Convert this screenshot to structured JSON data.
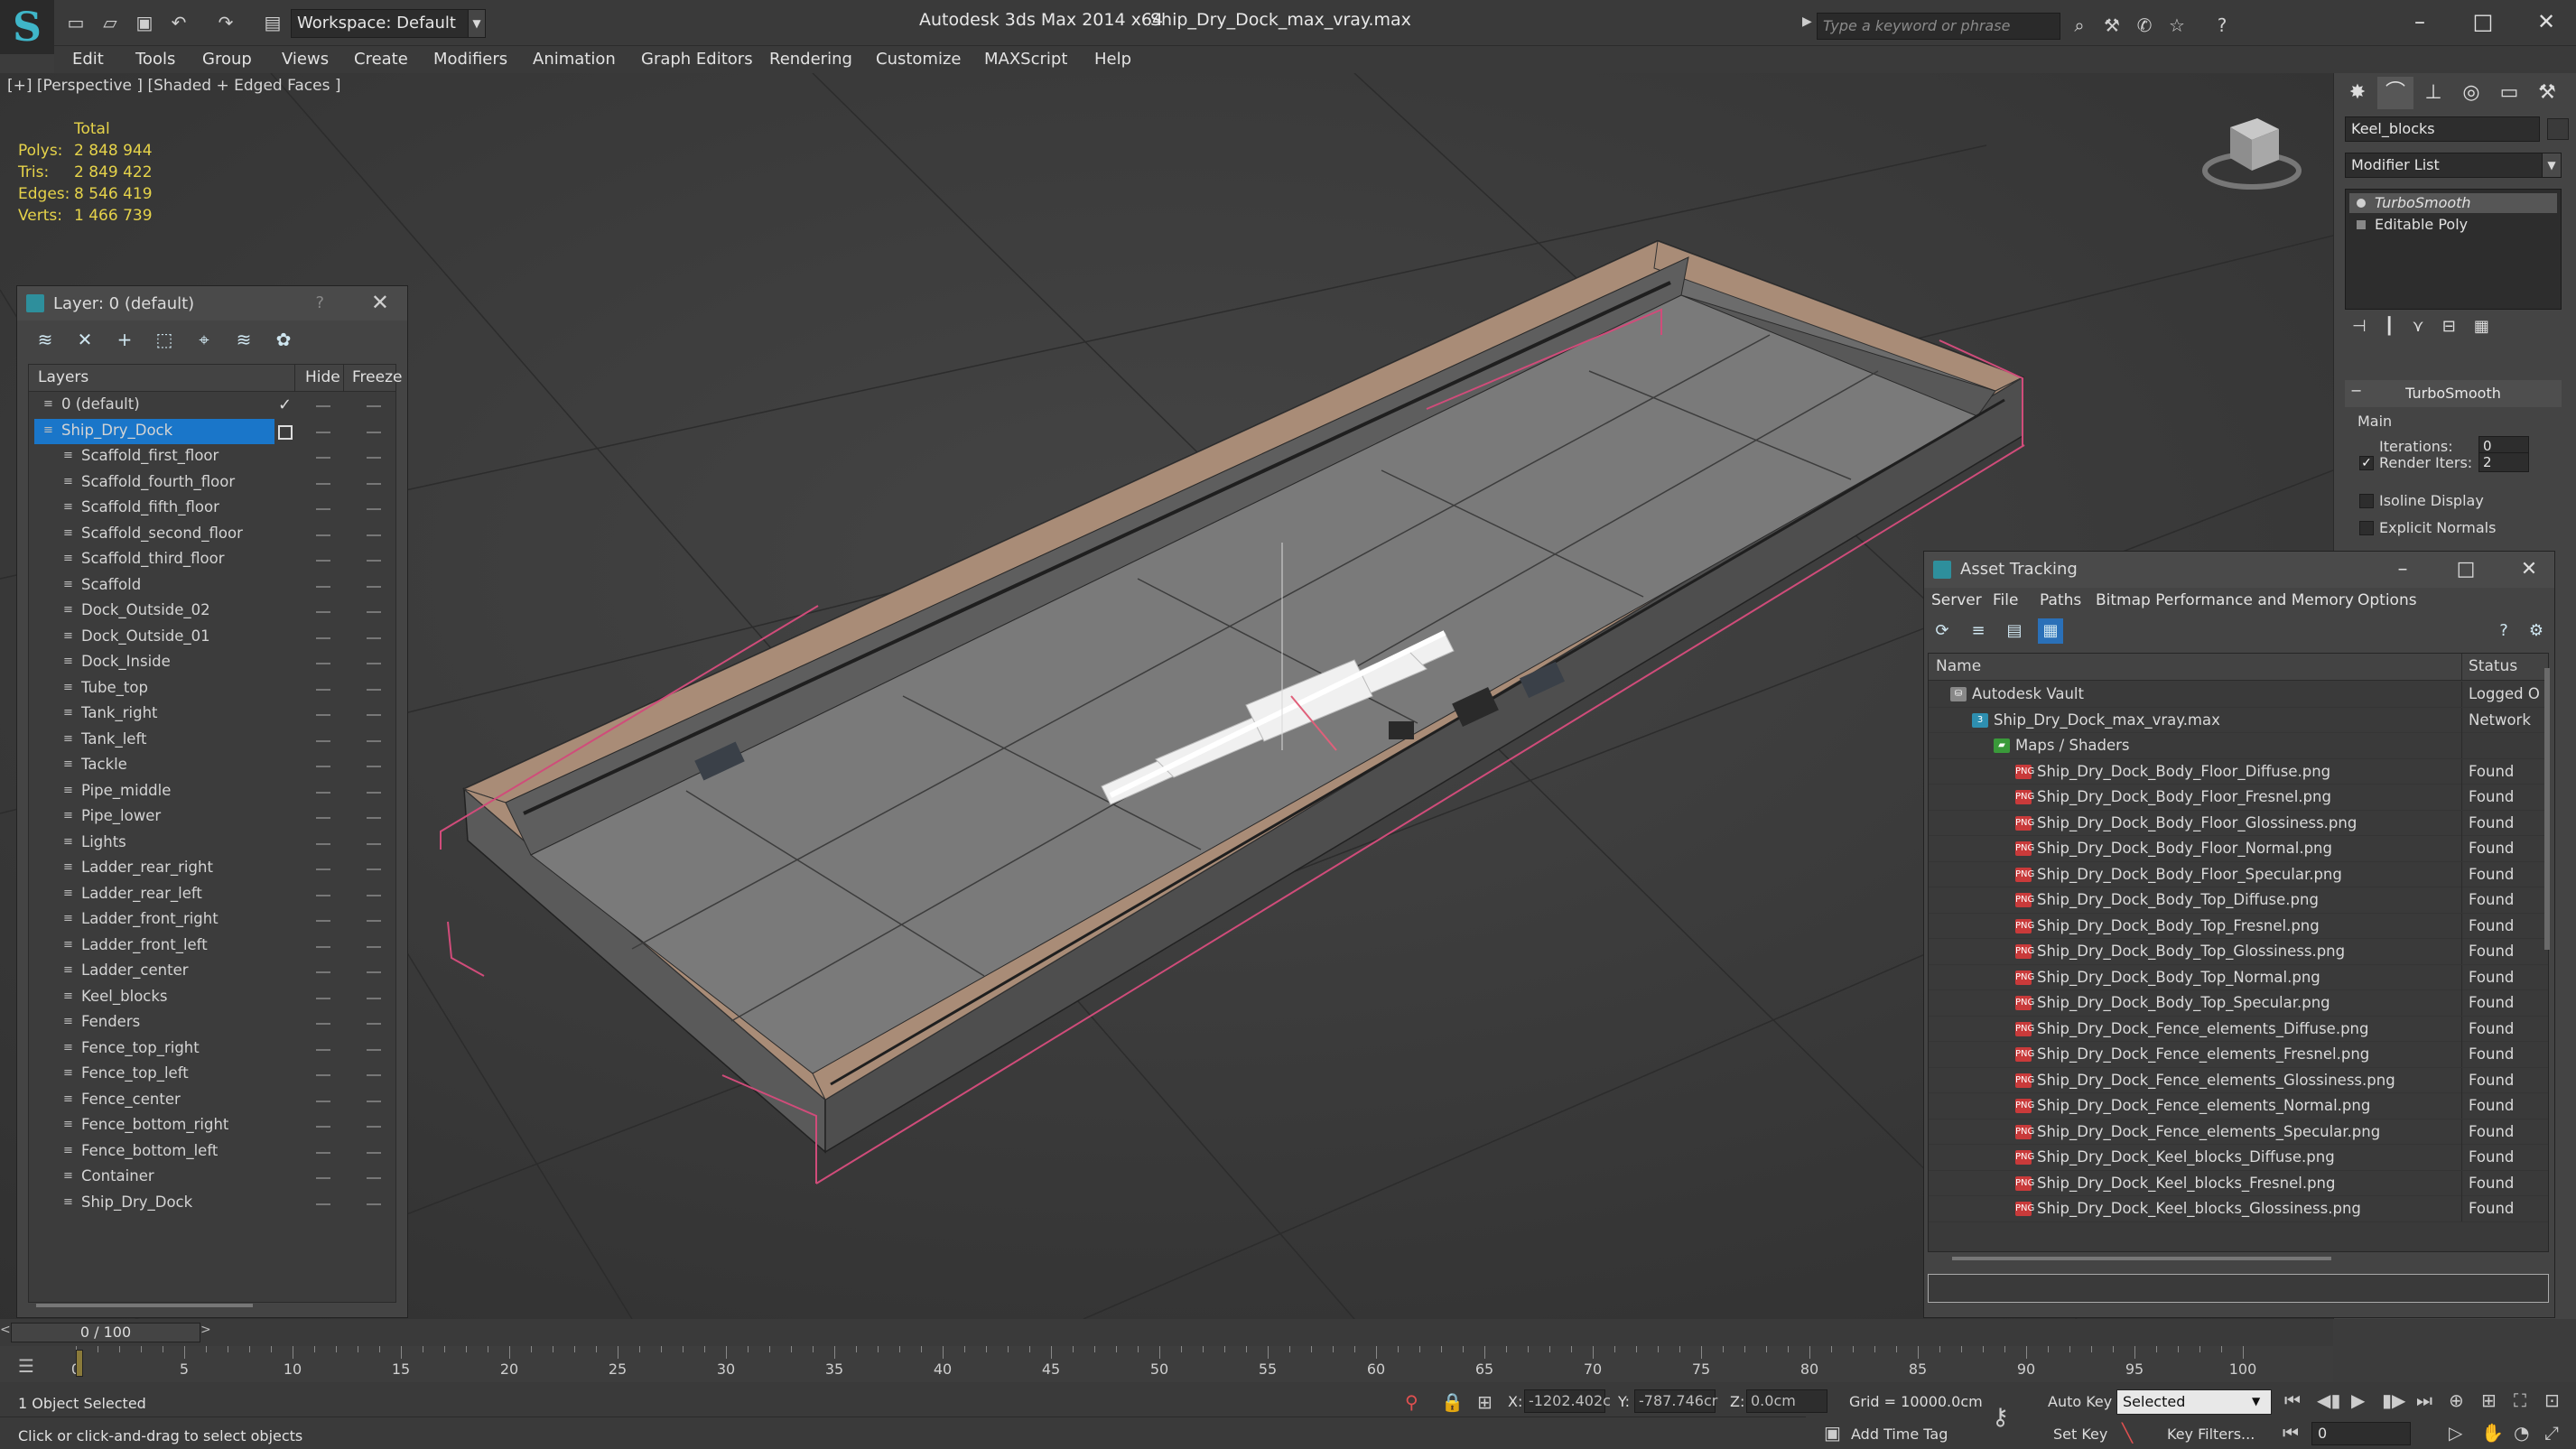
{
  "titlebar": {
    "workspace_label": "Workspace: Default",
    "app_title": "Autodesk 3ds Max  2014 x64",
    "file_title": "Ship_Dry_Dock_max_vray.max",
    "search_placeholder": "Type a keyword or phrase"
  },
  "menu": [
    "Edit",
    "Tools",
    "Group",
    "Views",
    "Create",
    "Modifiers",
    "Animation",
    "Graph Editors",
    "Rendering",
    "Customize",
    "MAXScript",
    "Help"
  ],
  "viewport": {
    "label": "[+] [Perspective ] [Shaded + Edged Faces ]",
    "stats": {
      "header": "Total",
      "rows": [
        {
          "k": "Polys:",
          "v": "2 848 944"
        },
        {
          "k": "Tris:",
          "v": "2 849 422"
        },
        {
          "k": "Edges:",
          "v": "8 546 419"
        },
        {
          "k": "Verts:",
          "v": "1 466 739"
        }
      ]
    }
  },
  "layer_panel": {
    "title": "Layer: 0 (default)",
    "help": "?",
    "col_layers": "Layers",
    "col_hide": "Hide",
    "col_freeze": "Freeze",
    "layers": [
      {
        "name": "0 (default)",
        "level": 0,
        "check": true
      },
      {
        "name": "Ship_Dry_Dock",
        "level": 0,
        "selected": true
      },
      {
        "name": "Scaffold_first_floor",
        "level": 1
      },
      {
        "name": "Scaffold_fourth_floor",
        "level": 1
      },
      {
        "name": "Scaffold_fifth_floor",
        "level": 1
      },
      {
        "name": "Scaffold_second_floor",
        "level": 1
      },
      {
        "name": "Scaffold_third_floor",
        "level": 1
      },
      {
        "name": "Scaffold",
        "level": 1
      },
      {
        "name": "Dock_Outside_02",
        "level": 1
      },
      {
        "name": "Dock_Outside_01",
        "level": 1
      },
      {
        "name": "Dock_Inside",
        "level": 1
      },
      {
        "name": "Tube_top",
        "level": 1
      },
      {
        "name": "Tank_right",
        "level": 1
      },
      {
        "name": "Tank_left",
        "level": 1
      },
      {
        "name": "Tackle",
        "level": 1
      },
      {
        "name": "Pipe_middle",
        "level": 1
      },
      {
        "name": "Pipe_lower",
        "level": 1
      },
      {
        "name": "Lights",
        "level": 1
      },
      {
        "name": "Ladder_rear_right",
        "level": 1
      },
      {
        "name": "Ladder_rear_left",
        "level": 1
      },
      {
        "name": "Ladder_front_right",
        "level": 1
      },
      {
        "name": "Ladder_front_left",
        "level": 1
      },
      {
        "name": "Ladder_center",
        "level": 1
      },
      {
        "name": "Keel_blocks",
        "level": 1
      },
      {
        "name": "Fenders",
        "level": 1
      },
      {
        "name": "Fence_top_right",
        "level": 1
      },
      {
        "name": "Fence_top_left",
        "level": 1
      },
      {
        "name": "Fence_center",
        "level": 1
      },
      {
        "name": "Fence_bottom_right",
        "level": 1
      },
      {
        "name": "Fence_bottom_left",
        "level": 1
      },
      {
        "name": "Container",
        "level": 1
      },
      {
        "name": "Ship_Dry_Dock",
        "level": 1
      }
    ]
  },
  "command_panel": {
    "object_name": "Keel_blocks",
    "modifier_list": "Modifier List",
    "stack": [
      "TurboSmooth",
      "Editable Poly"
    ],
    "rollout_title": "TurboSmooth",
    "main_label": "Main",
    "iterations_label": "Iterations:",
    "iterations_value": "0",
    "render_iters_label": "Render Iters:",
    "render_iters_value": "2",
    "isoline_label": "Isoline Display",
    "explicit_normals_label": "Explicit Normals"
  },
  "asset_tracking": {
    "title": "Asset Tracking",
    "menu": [
      "Server",
      "File",
      "Paths",
      "Bitmap Performance and Memory",
      "Options"
    ],
    "col_name": "Name",
    "col_status": "Status",
    "rows": [
      {
        "name": "Autodesk Vault",
        "status": "Logged O",
        "indent": 1,
        "icon": "vault"
      },
      {
        "name": "Ship_Dry_Dock_max_vray.max",
        "status": "Network",
        "indent": 2,
        "icon": "max"
      },
      {
        "name": "Maps / Shaders",
        "status": "",
        "indent": 3,
        "icon": "folder"
      },
      {
        "name": "Ship_Dry_Dock_Body_Floor_Diffuse.png",
        "status": "Found",
        "indent": 4,
        "icon": "png"
      },
      {
        "name": "Ship_Dry_Dock_Body_Floor_Fresnel.png",
        "status": "Found",
        "indent": 4,
        "icon": "png"
      },
      {
        "name": "Ship_Dry_Dock_Body_Floor_Glossiness.png",
        "status": "Found",
        "indent": 4,
        "icon": "png"
      },
      {
        "name": "Ship_Dry_Dock_Body_Floor_Normal.png",
        "status": "Found",
        "indent": 4,
        "icon": "png"
      },
      {
        "name": "Ship_Dry_Dock_Body_Floor_Specular.png",
        "status": "Found",
        "indent": 4,
        "icon": "png"
      },
      {
        "name": "Ship_Dry_Dock_Body_Top_Diffuse.png",
        "status": "Found",
        "indent": 4,
        "icon": "png"
      },
      {
        "name": "Ship_Dry_Dock_Body_Top_Fresnel.png",
        "status": "Found",
        "indent": 4,
        "icon": "png"
      },
      {
        "name": "Ship_Dry_Dock_Body_Top_Glossiness.png",
        "status": "Found",
        "indent": 4,
        "icon": "png"
      },
      {
        "name": "Ship_Dry_Dock_Body_Top_Normal.png",
        "status": "Found",
        "indent": 4,
        "icon": "png"
      },
      {
        "name": "Ship_Dry_Dock_Body_Top_Specular.png",
        "status": "Found",
        "indent": 4,
        "icon": "png"
      },
      {
        "name": "Ship_Dry_Dock_Fence_elements_Diffuse.png",
        "status": "Found",
        "indent": 4,
        "icon": "png"
      },
      {
        "name": "Ship_Dry_Dock_Fence_elements_Fresnel.png",
        "status": "Found",
        "indent": 4,
        "icon": "png"
      },
      {
        "name": "Ship_Dry_Dock_Fence_elements_Glossiness.png",
        "status": "Found",
        "indent": 4,
        "icon": "png"
      },
      {
        "name": "Ship_Dry_Dock_Fence_elements_Normal.png",
        "status": "Found",
        "indent": 4,
        "icon": "png"
      },
      {
        "name": "Ship_Dry_Dock_Fence_elements_Specular.png",
        "status": "Found",
        "indent": 4,
        "icon": "png"
      },
      {
        "name": "Ship_Dry_Dock_Keel_blocks_Diffuse.png",
        "status": "Found",
        "indent": 4,
        "icon": "png"
      },
      {
        "name": "Ship_Dry_Dock_Keel_blocks_Fresnel.png",
        "status": "Found",
        "indent": 4,
        "icon": "png"
      },
      {
        "name": "Ship_Dry_Dock_Keel_blocks_Glossiness.png",
        "status": "Found",
        "indent": 4,
        "icon": "png"
      }
    ]
  },
  "timeline": {
    "slider_label": "0 / 100",
    "ticks": [
      "0",
      "5",
      "10",
      "15",
      "20",
      "25",
      "30",
      "35",
      "40",
      "45",
      "50",
      "55",
      "60",
      "65",
      "70",
      "75",
      "80",
      "85",
      "90",
      "95",
      "100"
    ]
  },
  "statusbar": {
    "selected_text": "1 Object Selected",
    "prompt_text": "Click or click-and-drag to select objects",
    "x_label": "X:",
    "x_value": "-1202.402c",
    "y_label": "Y:",
    "y_value": "-787.746cr",
    "z_label": "Z:",
    "z_value": "0.0cm",
    "grid_text": "Grid = 10000.0cm",
    "auto_key": "Auto Key",
    "selected_dropdown": "Selected",
    "set_key": "Set Key",
    "key_filters": "Key Filters...",
    "add_time_tag": "Add Time Tag",
    "frame_value": "0"
  }
}
